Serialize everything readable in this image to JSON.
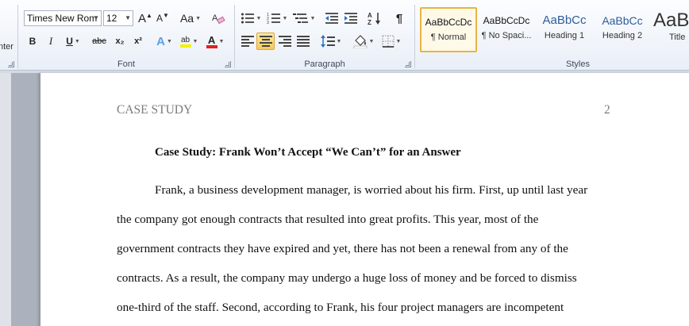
{
  "clipboard": {
    "partial_label": "nter"
  },
  "font": {
    "name": "Times New Rom",
    "size": "12",
    "grow_glyph": "A",
    "shrink_glyph": "A",
    "case_glyph": "Aa",
    "bold": "B",
    "italic": "I",
    "underline": "U",
    "strike": "abc",
    "subscript": "x₂",
    "superscript": "x²",
    "effects_glyph": "A",
    "highlight_glyph": "ab",
    "color_glyph": "A",
    "group_label": "Font"
  },
  "paragraph": {
    "group_label": "Paragraph",
    "pilcrow": "¶"
  },
  "styles": {
    "group_label": "Styles",
    "items": [
      {
        "sample": "AaBbCcDc",
        "name": "¶ Normal"
      },
      {
        "sample": "AaBbCcDc",
        "name": "¶ No Spaci..."
      },
      {
        "sample": "AaBbCc",
        "name": "Heading 1"
      },
      {
        "sample": "AaBbCc",
        "name": "Heading 2"
      },
      {
        "sample": "AaB",
        "name": "Title"
      }
    ]
  },
  "colors": {
    "highlight": "#f6f000",
    "font_color": "#e02020",
    "heading": "#2c5d9a",
    "header_text": "#7b7b7b"
  },
  "document": {
    "header_left": "CASE STUDY",
    "page_number": "2",
    "title": "Case Study: Frank Won’t Accept “We Can’t” for an Answer",
    "lines": [
      "Frank, a business  development manager,  is worried about his firm. First, up until last year",
      "the company got enough contracts that resulted into great profits. This year, most of the",
      "government contracts they have expired and yet, there has not been a renewal from any of the",
      "contracts. As a result, the company may undergo a huge loss of money and be forced to dismiss",
      "one-third of the staff. Second, according to Frank, his four project managers are incompetent"
    ]
  }
}
